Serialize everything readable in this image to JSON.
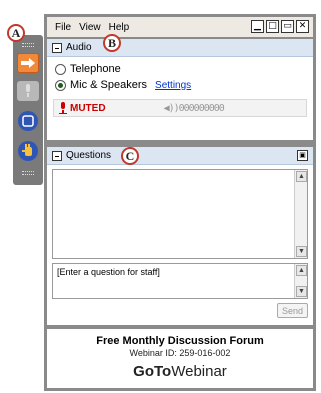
{
  "callouts": {
    "a": "A",
    "b": "B",
    "c": "C"
  },
  "menu": {
    "file": "File",
    "view": "View",
    "help": "Help"
  },
  "window_buttons": [
    "▁",
    "□",
    "▭",
    "✕"
  ],
  "audio": {
    "title": "Audio",
    "telephone": "Telephone",
    "mic": "Mic & Speakers",
    "settings": "Settings",
    "muted": "MUTED",
    "level": "◀))000000000"
  },
  "questions": {
    "title": "Questions",
    "input_placeholder": "[Enter a question for staff]",
    "send": "Send"
  },
  "footer": {
    "title": "Free Monthly Discussion Forum",
    "webinar_id": "Webinar ID: 259-016-002",
    "logo_bold": "GoTo",
    "logo_rest": "Webinar"
  },
  "colors": {
    "accent": "#e8542a",
    "muted_red": "#cc0000",
    "header_blue": "#dce6f2"
  }
}
